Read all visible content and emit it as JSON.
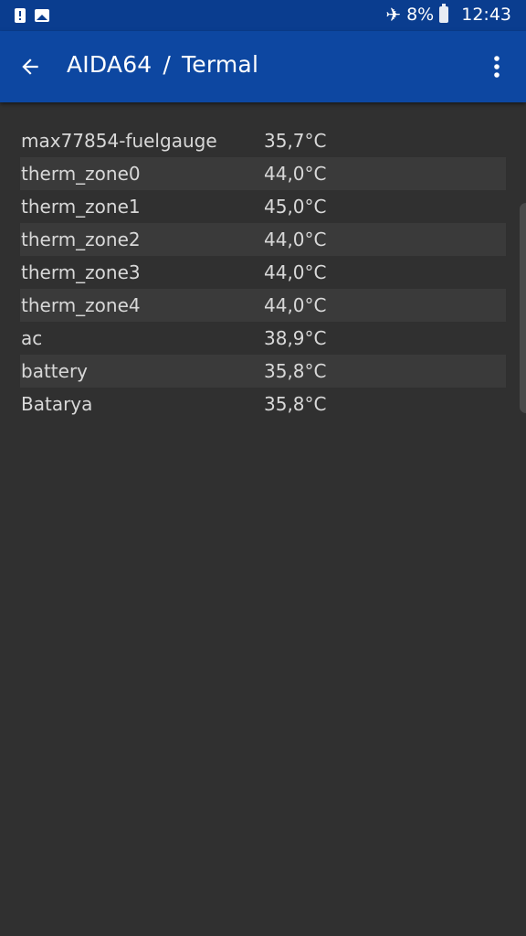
{
  "status_bar": {
    "battery_percent": "8%",
    "time": "12:43",
    "icons": [
      "alert-icon",
      "image-notification-icon",
      "airplane-mode-icon",
      "battery-icon"
    ]
  },
  "app_bar": {
    "app_name": "AIDA64",
    "separator": "/",
    "section": "Termal",
    "icons": [
      "back-arrow-icon",
      "more-vert-icon"
    ]
  },
  "colors": {
    "app_bar": "#0d47a1",
    "status_bar": "#0a3d8f",
    "background": "#303030",
    "row_alt": "#3a3a3a",
    "text": "#d8d8d8"
  },
  "sensors": [
    {
      "name": "max77854-fuelgauge",
      "value": "35,7°C"
    },
    {
      "name": "therm_zone0",
      "value": "44,0°C"
    },
    {
      "name": "therm_zone1",
      "value": "45,0°C"
    },
    {
      "name": "therm_zone2",
      "value": "44,0°C"
    },
    {
      "name": "therm_zone3",
      "value": "44,0°C"
    },
    {
      "name": "therm_zone4",
      "value": "44,0°C"
    },
    {
      "name": "ac",
      "value": "38,9°C"
    },
    {
      "name": "battery",
      "value": "35,8°C"
    },
    {
      "name": "Batarya",
      "value": "35,8°C"
    }
  ]
}
